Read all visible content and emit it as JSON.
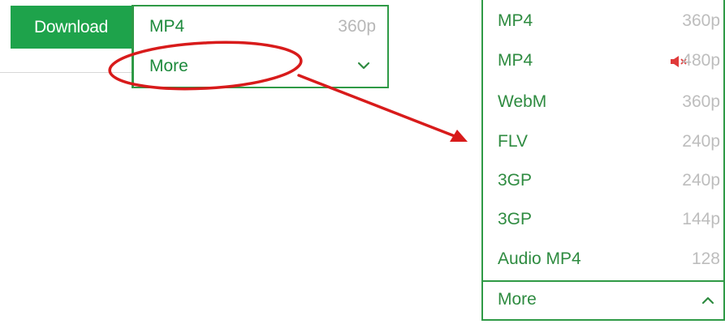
{
  "left_widget": {
    "download_label": "Download",
    "selected_format": "MP4",
    "selected_resolution": "360p",
    "more_label": "More"
  },
  "dropdown": {
    "items": [
      {
        "format": "MP4",
        "resolution": "360p",
        "muted": false
      },
      {
        "format": "MP4",
        "resolution": "480p",
        "muted": true
      },
      {
        "format": "WebM",
        "resolution": "360p",
        "muted": false
      },
      {
        "format": "FLV",
        "resolution": "240p",
        "muted": false
      },
      {
        "format": "3GP",
        "resolution": "240p",
        "muted": false
      },
      {
        "format": "3GP",
        "resolution": "144p",
        "muted": false
      },
      {
        "format": "Audio MP4",
        "resolution": "128",
        "muted": false
      }
    ],
    "more_label": "More"
  },
  "colors": {
    "brand_green": "#1ea34b",
    "border_green": "#2f9a46",
    "text_green": "#2e8b40",
    "muted_gray": "#bdbdbd",
    "annotation_red": "#d81b1b"
  },
  "icons": {
    "collapsed_chevron": "chevron-down-icon",
    "expanded_chevron": "chevron-up-icon",
    "muted": "speaker-muted-icon"
  }
}
